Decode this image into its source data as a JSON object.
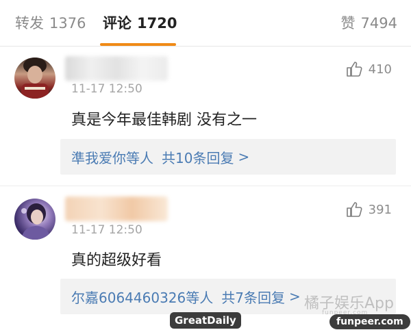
{
  "tabs": {
    "repost": {
      "label": "转发",
      "count": "1376"
    },
    "comments": {
      "label": "评论",
      "count": "1720"
    },
    "likes": {
      "label": "赞",
      "count": "7494"
    }
  },
  "comments": [
    {
      "time": "11-17 12:50",
      "likes": "410",
      "text": "真是今年最佳韩剧 没有之一",
      "replies": {
        "who": "準我爱你",
        "etc": "等人",
        "more": "共10条回复",
        "chevron": ">"
      }
    },
    {
      "time": "11-17 12:50",
      "likes": "391",
      "text": "真的超级好看",
      "replies": {
        "who": "尔嘉6064460326",
        "etc": "等人",
        "more": "共7条回复",
        "chevron": ">"
      }
    }
  ],
  "watermarks": {
    "main": "橘子娱乐App",
    "sub": "funpeer.com",
    "badge_left": "GreatDaily",
    "badge_right": "funpeer.com"
  },
  "colors": {
    "accent": "#f08a16",
    "link": "#4a7bb3"
  }
}
